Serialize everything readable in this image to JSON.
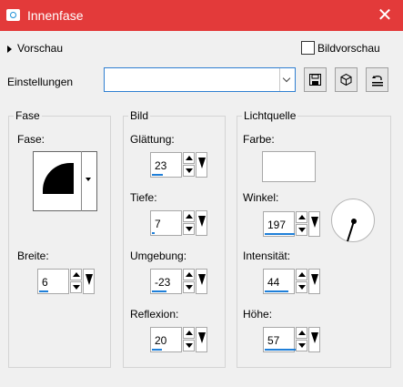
{
  "window": {
    "title": "Innenfase",
    "close_symbol": "✕"
  },
  "top": {
    "preview_label": "Vorschau",
    "image_preview_label": "Bildvorschau",
    "image_preview_checked": false
  },
  "settings": {
    "label": "Einstellungen",
    "value": ""
  },
  "fase_group": {
    "title": "Fase",
    "fase_label": "Fase:",
    "breite_label": "Breite:",
    "breite_value": "6"
  },
  "bild_group": {
    "title": "Bild",
    "glaettung_label": "Glättung:",
    "glaettung_value": "23",
    "tiefe_label": "Tiefe:",
    "tiefe_value": "7",
    "umgebung_label": "Umgebung:",
    "umgebung_value": "-23",
    "reflexion_label": "Reflexion:",
    "reflexion_value": "20"
  },
  "licht_group": {
    "title": "Lichtquelle",
    "farbe_label": "Farbe:",
    "farbe_color": "#ffffff",
    "winkel_label": "Winkel:",
    "winkel_value": "197",
    "intensitaet_label": "Intensität:",
    "intensitaet_value": "44",
    "hoehe_label": "Höhe:",
    "hoehe_value": "57"
  },
  "colors": {
    "titlebar": "#e33a3a",
    "accent": "#1f7fd8"
  },
  "icons": [
    "camera-icon",
    "close-icon",
    "expand-triangle-icon",
    "save-icon",
    "cube-icon",
    "reset-icon",
    "chevron-down-icon"
  ]
}
